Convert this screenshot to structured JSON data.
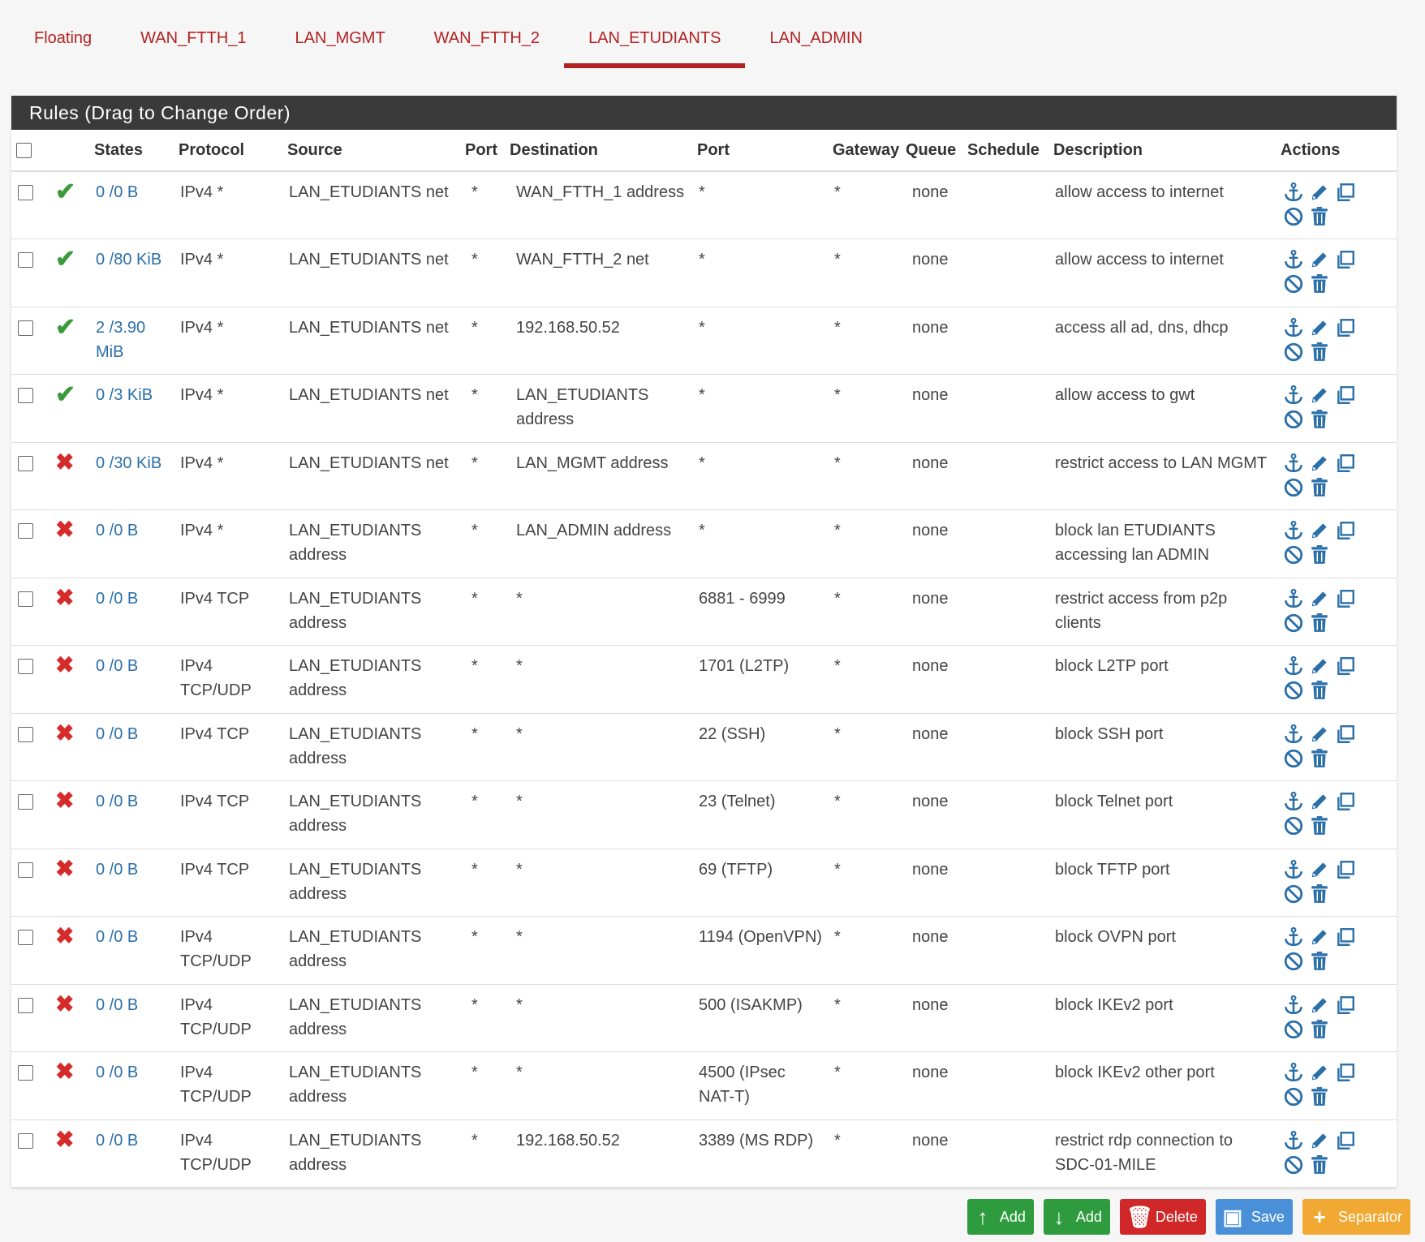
{
  "tabs": [
    {
      "label": "Floating",
      "active": false
    },
    {
      "label": "WAN_FTTH_1",
      "active": false
    },
    {
      "label": "LAN_MGMT",
      "active": false
    },
    {
      "label": "WAN_FTTH_2",
      "active": false
    },
    {
      "label": "LAN_ETUDIANTS",
      "active": true
    },
    {
      "label": "LAN_ADMIN",
      "active": false
    }
  ],
  "panel": {
    "title": "Rules (Drag to Change Order)"
  },
  "columns": {
    "states": "States",
    "protocol": "Protocol",
    "source": "Source",
    "port": "Port",
    "destination": "Destination",
    "dport": "Port",
    "gateway": "Gateway",
    "queue": "Queue",
    "schedule": "Schedule",
    "description": "Description",
    "actions": "Actions"
  },
  "rules": [
    {
      "status": "pass",
      "states": "0 /0 B",
      "protocol": "IPv4 *",
      "source": "LAN_ETUDIANTS net",
      "sport": "*",
      "destination": "WAN_FTTH_1 address",
      "dport": "*",
      "gateway": "*",
      "queue": "none",
      "schedule": "",
      "description": "allow access to internet"
    },
    {
      "status": "pass",
      "states": "0 /80 KiB",
      "protocol": "IPv4 *",
      "source": "LAN_ETUDIANTS net",
      "sport": "*",
      "destination": "WAN_FTTH_2 net",
      "dport": "*",
      "gateway": "*",
      "queue": "none",
      "schedule": "",
      "description": "allow access to internet"
    },
    {
      "status": "pass",
      "states": "2 /3.90 MiB",
      "protocol": "IPv4 *",
      "source": "LAN_ETUDIANTS net",
      "sport": "*",
      "destination": "192.168.50.52",
      "dport": "*",
      "gateway": "*",
      "queue": "none",
      "schedule": "",
      "description": "access all ad, dns, dhcp"
    },
    {
      "status": "pass",
      "states": "0 /3 KiB",
      "protocol": "IPv4 *",
      "source": "LAN_ETUDIANTS net",
      "sport": "*",
      "destination": "LAN_ETUDIANTS address",
      "dport": "*",
      "gateway": "*",
      "queue": "none",
      "schedule": "",
      "description": "allow access to gwt"
    },
    {
      "status": "block",
      "states": "0 /30 KiB",
      "protocol": "IPv4 *",
      "source": "LAN_ETUDIANTS net",
      "sport": "*",
      "destination": "LAN_MGMT address",
      "dport": "*",
      "gateway": "*",
      "queue": "none",
      "schedule": "",
      "description": "restrict access to LAN MGMT"
    },
    {
      "status": "block",
      "states": "0 /0 B",
      "protocol": "IPv4 *",
      "source": "LAN_ETUDIANTS address",
      "sport": "*",
      "destination": "LAN_ADMIN address",
      "dport": "*",
      "gateway": "*",
      "queue": "none",
      "schedule": "",
      "description": "block lan ETUDIANTS accessing lan ADMIN"
    },
    {
      "status": "block",
      "states": "0 /0 B",
      "protocol": "IPv4 TCP",
      "source": "LAN_ETUDIANTS address",
      "sport": "*",
      "destination": "*",
      "dport": "6881 - 6999",
      "gateway": "*",
      "queue": "none",
      "schedule": "",
      "description": "restrict access from p2p clients"
    },
    {
      "status": "block",
      "states": "0 /0 B",
      "protocol": "IPv4 TCP/UDP",
      "source": "LAN_ETUDIANTS address",
      "sport": "*",
      "destination": "*",
      "dport": "1701 (L2TP)",
      "gateway": "*",
      "queue": "none",
      "schedule": "",
      "description": "block L2TP port"
    },
    {
      "status": "block",
      "states": "0 /0 B",
      "protocol": "IPv4 TCP",
      "source": "LAN_ETUDIANTS address",
      "sport": "*",
      "destination": "*",
      "dport": "22 (SSH)",
      "gateway": "*",
      "queue": "none",
      "schedule": "",
      "description": "block SSH port"
    },
    {
      "status": "block",
      "states": "0 /0 B",
      "protocol": "IPv4 TCP",
      "source": "LAN_ETUDIANTS address",
      "sport": "*",
      "destination": "*",
      "dport": "23 (Telnet)",
      "gateway": "*",
      "queue": "none",
      "schedule": "",
      "description": "block Telnet port"
    },
    {
      "status": "block",
      "states": "0 /0 B",
      "protocol": "IPv4 TCP",
      "source": "LAN_ETUDIANTS address",
      "sport": "*",
      "destination": "*",
      "dport": "69 (TFTP)",
      "gateway": "*",
      "queue": "none",
      "schedule": "",
      "description": "block TFTP port"
    },
    {
      "status": "block",
      "states": "0 /0 B",
      "protocol": "IPv4 TCP/UDP",
      "source": "LAN_ETUDIANTS address",
      "sport": "*",
      "destination": "*",
      "dport": "1194 (OpenVPN)",
      "gateway": "*",
      "queue": "none",
      "schedule": "",
      "description": "block OVPN port"
    },
    {
      "status": "block",
      "states": "0 /0 B",
      "protocol": "IPv4 TCP/UDP",
      "source": "LAN_ETUDIANTS address",
      "sport": "*",
      "destination": "*",
      "dport": "500 (ISAKMP)",
      "gateway": "*",
      "queue": "none",
      "schedule": "",
      "description": "block IKEv2 port"
    },
    {
      "status": "block",
      "states": "0 /0 B",
      "protocol": "IPv4 TCP/UDP",
      "source": "LAN_ETUDIANTS address",
      "sport": "*",
      "destination": "*",
      "dport": "4500 (IPsec NAT-T)",
      "gateway": "*",
      "queue": "none",
      "schedule": "",
      "description": "block IKEv2 other port"
    },
    {
      "status": "block",
      "states": "0 /0 B",
      "protocol": "IPv4 TCP/UDP",
      "source": "LAN_ETUDIANTS address",
      "sport": "*",
      "destination": "192.168.50.52",
      "dport": "3389 (MS RDP)",
      "gateway": "*",
      "queue": "none",
      "schedule": "",
      "description": "restrict rdp connection to SDC-01-MILE"
    }
  ],
  "buttons": {
    "add_top": "Add",
    "add_bottom": "Add",
    "delete": "Delete",
    "save": "Save",
    "separator": "Separator"
  },
  "colors": {
    "accent": "#b22222",
    "pass": "#3c9a3c",
    "block": "#d62b2b",
    "link": "#2a6fa8"
  }
}
